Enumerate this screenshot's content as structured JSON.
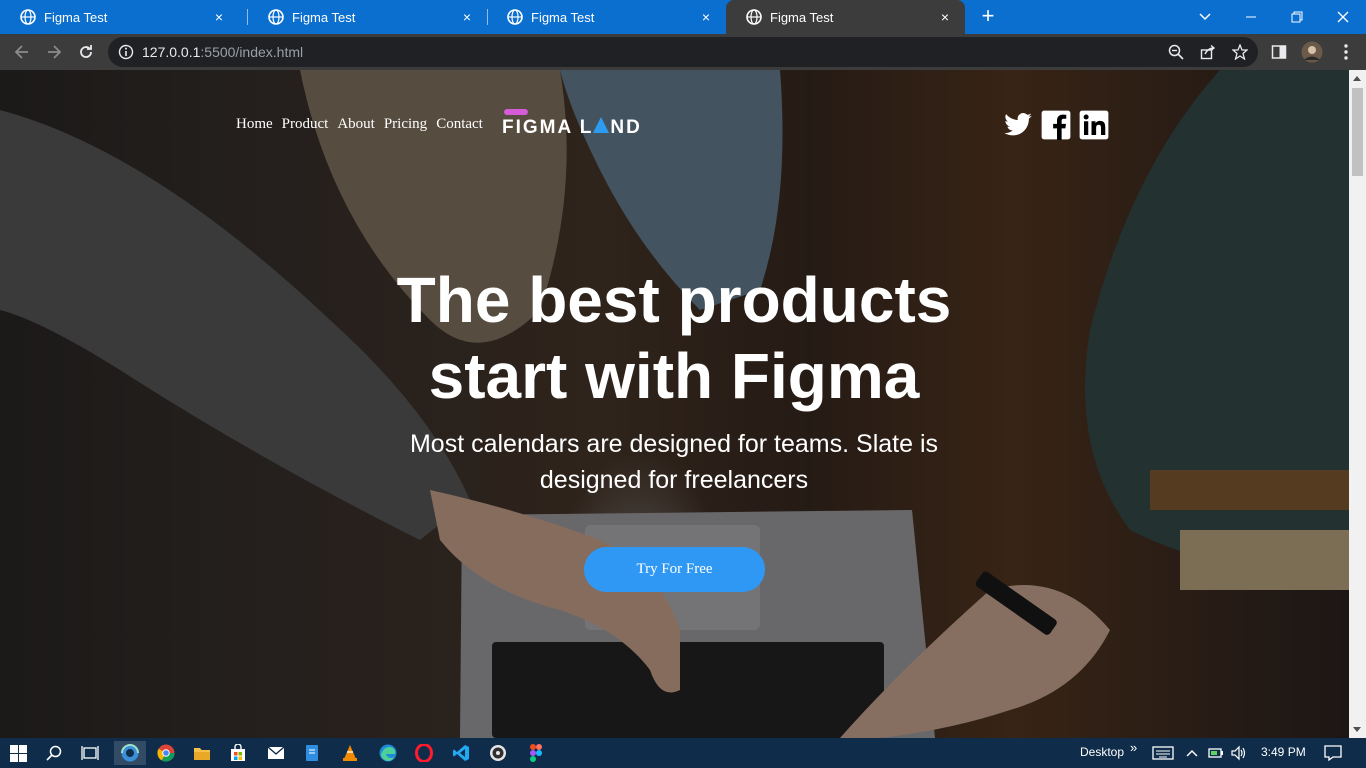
{
  "browser": {
    "tabs": [
      {
        "title": "Figma Test",
        "active": false
      },
      {
        "title": "Figma Test",
        "active": false
      },
      {
        "title": "Figma Test",
        "active": false
      },
      {
        "title": "Figma Test",
        "active": true
      }
    ],
    "tab_close_glyph": "×",
    "new_tab_glyph": "+",
    "url_host": "127.0.0.1",
    "url_rest": ":5500/index.html"
  },
  "page": {
    "nav": [
      "Home",
      "Product",
      "About",
      "Pricing",
      "Contact"
    ],
    "logo_text": "FIGMA L",
    "logo_text_end": "ND",
    "headline_line1": "The best products",
    "headline_line2": "start with Figma",
    "subhead_line1": "Most calendars are designed for teams. Slate is",
    "subhead_line2": "designed for freelancers",
    "cta_label": "Try For Free",
    "social_icons": [
      "twitter-icon",
      "facebook-icon",
      "linkedin-icon"
    ],
    "accent_color": "#2f98f4",
    "logo_pill_color": "#d55bd8"
  },
  "taskbar": {
    "desktop_label": "Desktop",
    "time": "3:49 PM"
  }
}
